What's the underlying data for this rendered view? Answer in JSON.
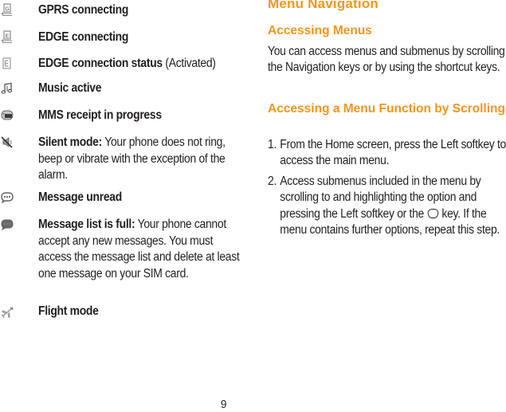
{
  "status_icons": [
    {
      "icon": "gprs-connecting-icon",
      "label": "GPRS connecting",
      "description": ""
    },
    {
      "icon": "edge-connecting-icon",
      "label": "EDGE connecting",
      "description": ""
    },
    {
      "icon": "edge-status-icon",
      "label": "EDGE connection status",
      "description": "(Activated)"
    },
    {
      "icon": "music-active-icon",
      "label": "Music active",
      "description": ""
    },
    {
      "icon": "mms-receipt-icon",
      "label": "MMS receipt in progress",
      "description": ""
    },
    {
      "icon": "silent-mode-icon",
      "label": "Silent mode:",
      "description": "Your phone does not ring, beep or vibrate with the exception of the alarm."
    },
    {
      "icon": "message-unread-icon",
      "label": "Message unread",
      "description": ""
    },
    {
      "icon": "message-list-full-icon",
      "label": "Message list is full:",
      "description": "Your phone cannot accept any new messages. You must access the message list and delete at least one message on your SIM card."
    },
    {
      "icon": "flight-mode-icon",
      "label": "Flight mode",
      "description": ""
    }
  ],
  "menu_navigation": {
    "title": "Menu Navigation",
    "accessing_menus": {
      "heading": "Accessing Menus",
      "text": "You can access menus and submenus by scrolling the Navigation keys or by using the shortcut keys."
    },
    "accessing_function": {
      "heading": "Accessing a Menu Function by Scrolling",
      "steps": [
        {
          "num": "1.",
          "text": "From the Home screen, press the Left softkey to access the main menu."
        },
        {
          "num": "2.",
          "text_before": "Access submenus included in the menu by scrolling to and highlighting the option and pressing the Left softkey or the",
          "key_icon": "ok-key-icon",
          "text_after": "key. If the menu contains further options, repeat this step."
        }
      ]
    }
  },
  "page_number": "9",
  "colors": {
    "heading": "#f7941d",
    "text": "#231f20",
    "icon": "#8a8a8a"
  }
}
